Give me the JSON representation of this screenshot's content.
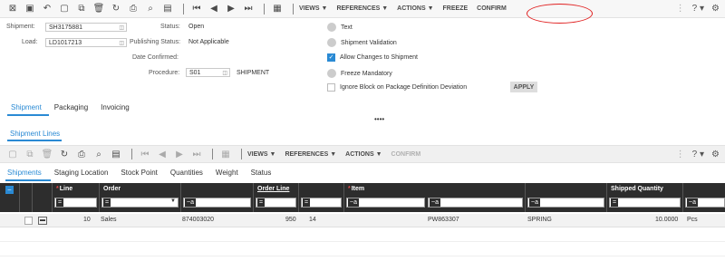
{
  "toolbar": {
    "menus": {
      "views": "VIEWS ▼",
      "references": "REFERENCES ▼",
      "actions": "ACTIONS ▼",
      "freeze": "FREEZE",
      "confirm": "CONFIRM"
    },
    "help": "? ▾",
    "icons": [
      "filter-icon",
      "save-icon",
      "undo-icon",
      "new-icon",
      "copy-icon",
      "delete-icon",
      "refresh-icon",
      "print-icon",
      "search-icon",
      "clipboard-icon",
      "first-icon",
      "prev-icon",
      "next-icon",
      "last-icon",
      "calendar-icon",
      "settings-icon"
    ]
  },
  "header": {
    "shipment_label": "Shipment:",
    "shipment_value": "SH3175881",
    "load_label": "Load:",
    "load_value": "LD1017213",
    "status_label": "Status:",
    "status_value": "Open",
    "pub_status_label": "Publishing Status:",
    "pub_status_value": "Not Applicable",
    "date_confirmed_label": "Date Confirmed:",
    "procedure_label": "Procedure:",
    "procedure_value": "S01",
    "procedure_name": "SHIPMENT"
  },
  "options": {
    "text": "Text",
    "shipment_validation": "Shipment Validation",
    "allow_changes": "Allow Changes to Shipment",
    "freeze_mandatory": "Freeze Mandatory",
    "ignore_block": "Ignore Block on Package Definition Deviation",
    "apply": "APPLY"
  },
  "tabs": [
    "Shipment",
    "Packaging",
    "Invoicing"
  ],
  "more": "••••",
  "section_title": "Shipment Lines",
  "lines_toolbar": {
    "views": "VIEWS ▼",
    "references": "REFERENCES ▼",
    "actions": "ACTIONS ▼",
    "confirm": "CONFIRM",
    "help": "? ▾"
  },
  "subtabs": [
    "Shipments",
    "Staging Location",
    "Stock Point",
    "Quantities",
    "Weight",
    "Status"
  ],
  "grid": {
    "columns": {
      "line": "Line",
      "order": "Order",
      "order_line": "Order Line",
      "item": "Item",
      "shipped_qty": "Shipped Quantity"
    },
    "row": {
      "line": "10",
      "order_type": "Sales",
      "order": "874003020",
      "order_line": "950",
      "seq": "14",
      "item": "PW863307",
      "item_desc": "SPRING",
      "qty": "10.0000",
      "unit": "Pcs"
    }
  },
  "colors": {
    "accent": "#2a8ad4",
    "grid_header": "#2d2d2d",
    "highlight": "#e02020"
  }
}
